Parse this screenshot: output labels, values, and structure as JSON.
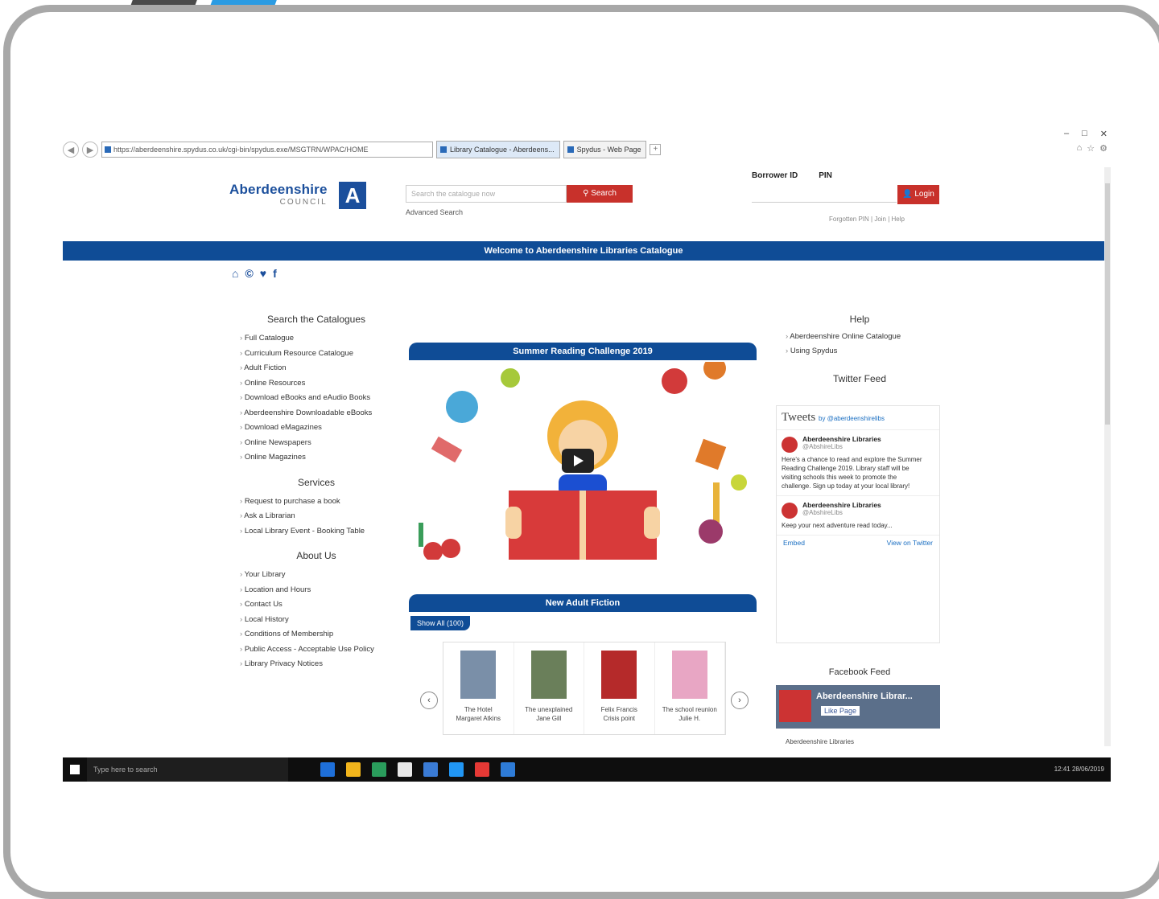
{
  "browser": {
    "url": "https://aberdeenshire.spydus.co.uk/cgi-bin/spydus.exe/MSGTRN/WPAC/HOME",
    "tabs": [
      {
        "label": "Library Catalogue - Aberdeens..."
      },
      {
        "label": "Spydus - Web Page"
      }
    ],
    "window_controls": [
      "–",
      "□",
      "✕"
    ],
    "toolbar_icons": [
      "⌂",
      "☆",
      "⚙"
    ]
  },
  "header": {
    "logo_name": "Aberdeenshire",
    "logo_sub": "COUNCIL",
    "logo_mark": "A",
    "search_placeholder": "Search the catalogue now",
    "search_button": "Search",
    "advanced_link": "Advanced Search",
    "login_label_user": "Borrower ID",
    "login_label_pin": "PIN",
    "login_button": "Login",
    "login_links": "Forgotten PIN | Join | Help"
  },
  "banner": "Welcome to Aberdeenshire Libraries Catalogue",
  "social_icons": [
    "⌂",
    "©",
    "♥",
    "f"
  ],
  "left": {
    "search_title": "Search the Catalogues",
    "search_items": [
      "Full Catalogue",
      "Curriculum Resource Catalogue",
      "Adult Fiction",
      "Online Resources",
      "Download eBooks and eAudio Books",
      "Aberdeenshire Downloadable eBooks",
      "Download eMagazines",
      "Online Newspapers",
      "Online Magazines"
    ],
    "services_title": "Services",
    "services_items": [
      "Request to purchase a book",
      "Ask a Librarian",
      "Local Library Event - Booking Table"
    ],
    "about_title": "About Us",
    "about_items": [
      "Your Library",
      "Location and Hours",
      "Contact Us",
      "Local History",
      "Conditions of Membership",
      "Public Access - Acceptable Use Policy",
      "Library Privacy Notices"
    ]
  },
  "center": {
    "video_title": "Summer Reading Challenge 2019",
    "fiction_title": "New Adult Fiction",
    "show_all": "Show All (100)",
    "books": [
      {
        "title": "The Hotel",
        "sub": "Margaret Atkins",
        "color": "#7a8fa8"
      },
      {
        "title": "The unexplained",
        "sub": "Jane Gill",
        "color": "#6a7f5a"
      },
      {
        "title": "Felix Francis",
        "sub": "Crisis point",
        "color": "#b52a2a"
      },
      {
        "title": "The school reunion",
        "sub": "Julie H.",
        "color": "#e8a6c4"
      }
    ],
    "prev": "‹",
    "next": "›"
  },
  "right": {
    "help_title": "Help",
    "help_items": [
      "Aberdeenshire Online Catalogue",
      "Using Spydus"
    ],
    "twitter_title": "Twitter Feed",
    "twitter_head": "Tweets",
    "twitter_by": "by @aberdeenshirelibs",
    "tweets": [
      {
        "name": "Aberdeenshire Libraries",
        "handle": "@AbshireLibs",
        "text": "Here's a chance to read and explore the Summer Reading Challenge 2019. Library staff will be visiting schools this week to promote the challenge. Sign up today at your local library!"
      },
      {
        "name": "Aberdeenshire Libraries",
        "handle": "@AbshireLibs",
        "text": "Keep your next adventure read today..."
      }
    ],
    "twitter_embed": "Embed",
    "twitter_view": "View on Twitter",
    "facebook_title": "Facebook Feed",
    "facebook_name": "Aberdeenshire Librar...",
    "facebook_like": "Like Page",
    "facebook_text": "Aberdeenshire Libraries"
  },
  "taskbar": {
    "search": "Type here to search",
    "icon_colors": [
      "#1e6fd9",
      "#f2b51c",
      "#2a9d5c",
      "#e8e8e8",
      "#3a7bd5",
      "#2196f3",
      "#e53935",
      "#2e7bd6"
    ],
    "tray_time": "12:41 28/06/2019"
  }
}
